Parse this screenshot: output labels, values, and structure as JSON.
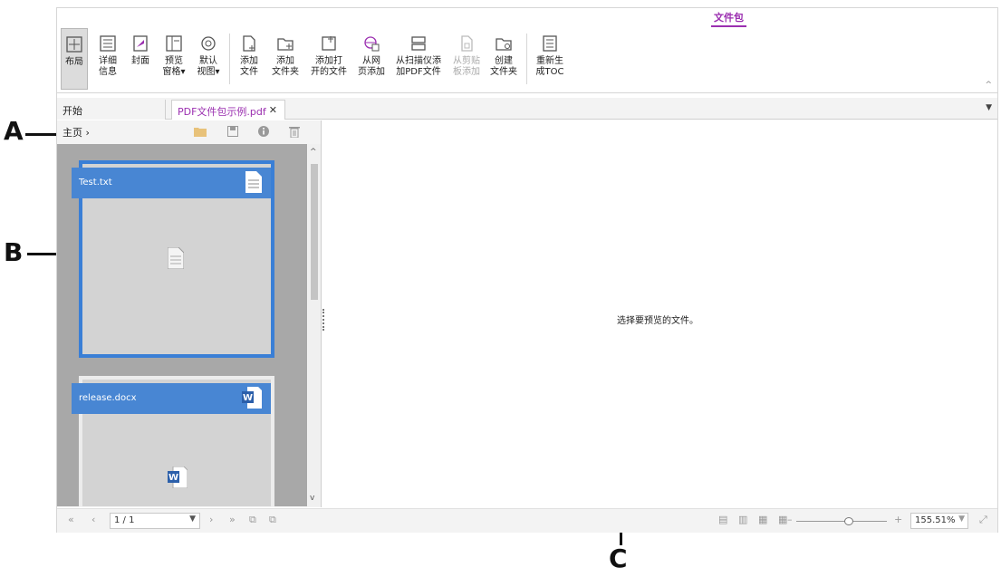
{
  "ribbon": {
    "active_tab": "文件包",
    "buttons": [
      {
        "id": "layout",
        "label": "布局",
        "icon": "layout-icon",
        "selected": true
      },
      {
        "id": "details",
        "label": "详细\n信息",
        "icon": "details-list-icon"
      },
      {
        "id": "cover",
        "label": "封面",
        "icon": "cover-icon"
      },
      {
        "id": "preview-pane",
        "label": "预览\n窗格▾",
        "icon": "preview-pane-icon"
      },
      {
        "id": "default-view",
        "label": "默认\n视图▾",
        "icon": "default-view-icon"
      },
      {
        "id": "add-file",
        "label": "添加\n文件",
        "icon": "add-file-icon"
      },
      {
        "id": "add-folder",
        "label": "添加\n文件夹",
        "icon": "add-folder-icon"
      },
      {
        "id": "add-open-file",
        "label": "添加打\n开的文件",
        "icon": "add-open-file-icon"
      },
      {
        "id": "from-web",
        "label": "从网\n页添加",
        "icon": "web-globe-icon"
      },
      {
        "id": "from-scanner",
        "label": "从扫描仪添\n加PDF文件",
        "icon": "scanner-icon"
      },
      {
        "id": "from-clipboard",
        "label": "从剪贴\n板添加",
        "icon": "clipboard-icon",
        "disabled": true
      },
      {
        "id": "create-folder",
        "label": "创建\n文件夹",
        "icon": "create-folder-icon"
      },
      {
        "id": "regen-toc",
        "label": "重新生\n成TOC",
        "icon": "toc-icon"
      }
    ]
  },
  "doc_tabs": [
    {
      "label": "开始"
    },
    {
      "label": "PDF文件包示例.pdf",
      "active": true
    }
  ],
  "panel": {
    "breadcrumb": "主页 ›",
    "items": [
      {
        "name": "Test.txt",
        "type": "txt-file-icon"
      },
      {
        "name": "release.docx",
        "type": "word-file-icon"
      }
    ]
  },
  "preview": {
    "message": "选择要预览的文件。"
  },
  "status": {
    "page": "1 / 1",
    "zoom": "155.51%",
    "zoom_level": 0.58
  },
  "callouts": {
    "a": "A",
    "b": "B",
    "c": "C"
  }
}
